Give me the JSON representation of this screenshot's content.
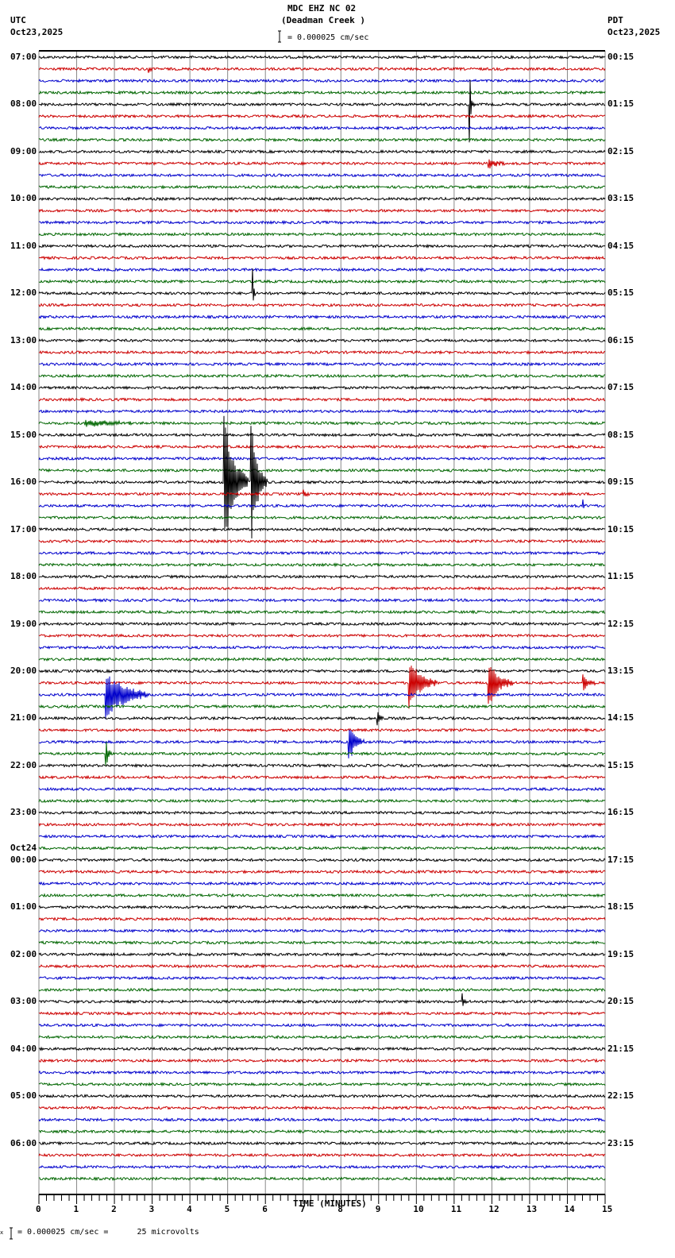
{
  "header": {
    "station": "MDC EHZ NC 02",
    "name": "(Deadman Creek )",
    "left_tz": "UTC",
    "left_date": "Oct23,2025",
    "right_tz": "PDT",
    "right_date": "Oct23,2025",
    "scale_text": "= 0.000025 cm/sec"
  },
  "footer": {
    "scale_text": "= 0.000025 cm/sec =      25 microvolts",
    "mark": "x"
  },
  "chart_data": {
    "type": "line",
    "title": "MDC EHZ NC 02 (Deadman Creek )",
    "xlabel": "TIME (MINUTES)",
    "xlim": [
      0,
      15
    ],
    "x_ticks": [
      "0",
      "1",
      "2",
      "3",
      "4",
      "5",
      "6",
      "7",
      "8",
      "9",
      "10",
      "11",
      "12",
      "13",
      "14",
      "15"
    ],
    "traces_per_hour": 4,
    "trace_colors": [
      "#000000",
      "#cc0000",
      "#0000cc",
      "#006600"
    ],
    "left_labels": [
      "07:00",
      "08:00",
      "09:00",
      "10:00",
      "11:00",
      "12:00",
      "13:00",
      "14:00",
      "15:00",
      "16:00",
      "17:00",
      "18:00",
      "19:00",
      "20:00",
      "21:00",
      "22:00",
      "23:00",
      "00:00",
      "01:00",
      "02:00",
      "03:00",
      "04:00",
      "05:00",
      "06:00"
    ],
    "date_change_label": "Oct24",
    "right_labels": [
      "00:15",
      "01:15",
      "02:15",
      "03:15",
      "04:15",
      "05:15",
      "06:15",
      "07:15",
      "08:15",
      "09:15",
      "10:15",
      "11:15",
      "12:15",
      "13:15",
      "14:15",
      "15:15",
      "16:15",
      "17:15",
      "18:15",
      "19:15",
      "20:15",
      "21:15",
      "22:15",
      "23:15"
    ],
    "events": [
      {
        "trace": 1,
        "minute": 2.9,
        "amp": 0.4,
        "dur": 0.1
      },
      {
        "trace": 4,
        "minute": 11.4,
        "amp": 5.5,
        "dur": 0.05
      },
      {
        "trace": 9,
        "minute": 11.9,
        "amp": 0.5,
        "dur": 0.4
      },
      {
        "trace": 20,
        "minute": 5.65,
        "amp": 3.2,
        "dur": 0.05
      },
      {
        "trace": 31,
        "minute": 1.2,
        "amp": 0.3,
        "dur": 1.5
      },
      {
        "trace": 37,
        "minute": 7.0,
        "amp": 0.6,
        "dur": 0.1
      },
      {
        "trace": 38,
        "minute": 14.4,
        "amp": 0.8,
        "dur": 0.05
      },
      {
        "trace": 36,
        "minute": 4.9,
        "amp": 6,
        "dur": 0.5
      },
      {
        "trace": 36,
        "minute": 5.6,
        "amp": 6.5,
        "dur": 0.3
      },
      {
        "trace": 53,
        "minute": 9.8,
        "amp": 2.2,
        "dur": 0.6
      },
      {
        "trace": 53,
        "minute": 11.9,
        "amp": 2.2,
        "dur": 0.5
      },
      {
        "trace": 53,
        "minute": 14.4,
        "amp": 0.8,
        "dur": 0.3
      },
      {
        "trace": 54,
        "minute": 1.75,
        "amp": 2.2,
        "dur": 1.0
      },
      {
        "trace": 56,
        "minute": 8.95,
        "amp": 1.2,
        "dur": 0.1
      },
      {
        "trace": 58,
        "minute": 8.2,
        "amp": 2.0,
        "dur": 0.3
      },
      {
        "trace": 59,
        "minute": 1.75,
        "amp": 2.5,
        "dur": 0.1
      },
      {
        "trace": 80,
        "minute": 11.2,
        "amp": 0.9,
        "dur": 0.1
      }
    ]
  }
}
